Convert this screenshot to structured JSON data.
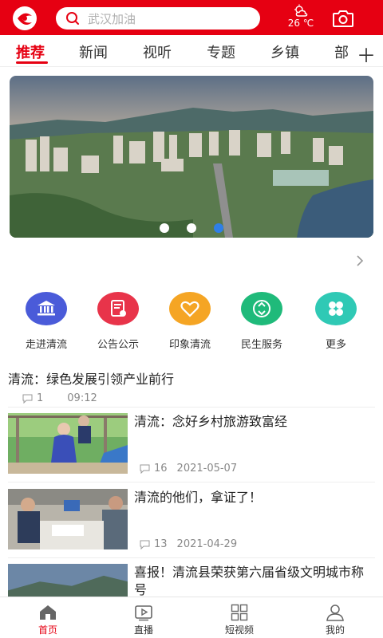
{
  "header": {
    "search_placeholder": "武汉加油",
    "weather_temp": "26 ℃",
    "weather_icon": "partly-cloudy-icon",
    "brand_color": "#e60012"
  },
  "tabs": [
    {
      "label": "推荐",
      "active": true
    },
    {
      "label": "新闻"
    },
    {
      "label": "视听"
    },
    {
      "label": "专题"
    },
    {
      "label": "乡镇"
    },
    {
      "label": "部"
    }
  ],
  "banner": {
    "slide_count": 3,
    "active_slide": 3
  },
  "quick_menu": [
    {
      "label": "走进清流",
      "icon": "building-icon",
      "color": "#4a5bd9",
      "badge": "走进清流"
    },
    {
      "label": "公告公示",
      "icon": "notice-icon",
      "color": "#e8344a"
    },
    {
      "label": "印象清流",
      "icon": "heart-icon",
      "color": "#f5a524"
    },
    {
      "label": "民生服务",
      "icon": "recycle-icon",
      "color": "#1fba7a"
    },
    {
      "label": "更多",
      "icon": "grid-icon",
      "color": "#2fc9b5"
    }
  ],
  "news_top": {
    "title": "清流：绿色发展引领产业前行",
    "comments": "1",
    "time": "09:12"
  },
  "news": [
    {
      "title": "清流：念好乡村旅游致富经",
      "comments": "16",
      "date": "2021-05-07"
    },
    {
      "title": "清流的他们，拿证了！",
      "comments": "13",
      "date": "2021-04-29"
    },
    {
      "title": "喜报！清流县荣获第六届省级文明城市称号",
      "comments": "",
      "date": ""
    }
  ],
  "bottom_nav": [
    {
      "label": "首页",
      "icon": "home-icon",
      "active": true
    },
    {
      "label": "直播",
      "icon": "live-icon"
    },
    {
      "label": "短视频",
      "icon": "short-video-icon"
    },
    {
      "label": "我的",
      "icon": "user-icon"
    }
  ]
}
